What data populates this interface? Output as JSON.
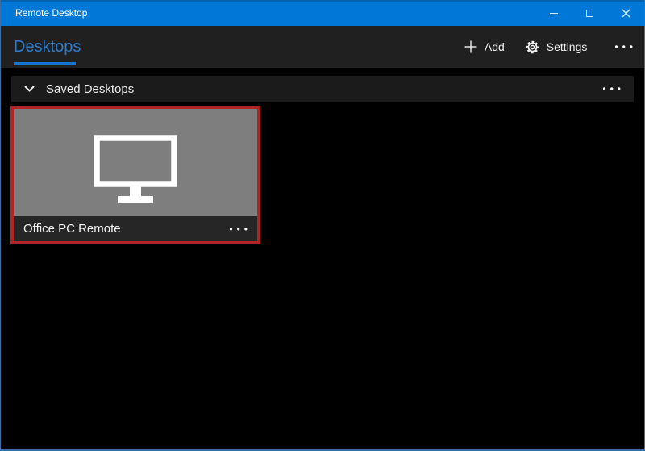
{
  "titlebar": {
    "title": "Remote Desktop"
  },
  "header": {
    "tab_desktops": "Desktops",
    "add_label": "Add",
    "settings_label": "Settings",
    "more_label": "•••"
  },
  "saved_desktops": {
    "title": "Saved Desktops",
    "more_label": "•••"
  },
  "tiles": [
    {
      "name": "Office PC Remote",
      "more_label": "•••",
      "highlighted": true
    }
  ],
  "colors": {
    "titlebar_blue": "#0078d7",
    "header_bg": "#202020",
    "main_bg": "#000000",
    "tab_blue": "#2e7cc9",
    "tab_underline": "#1574cf",
    "saved_bar_bg": "#1b1b1b",
    "tile_highlight_red": "#b32428",
    "tile_gray": "#7e7e7e",
    "tile_label_bg": "#262626",
    "window_border_blue": "#3a6ea5"
  }
}
